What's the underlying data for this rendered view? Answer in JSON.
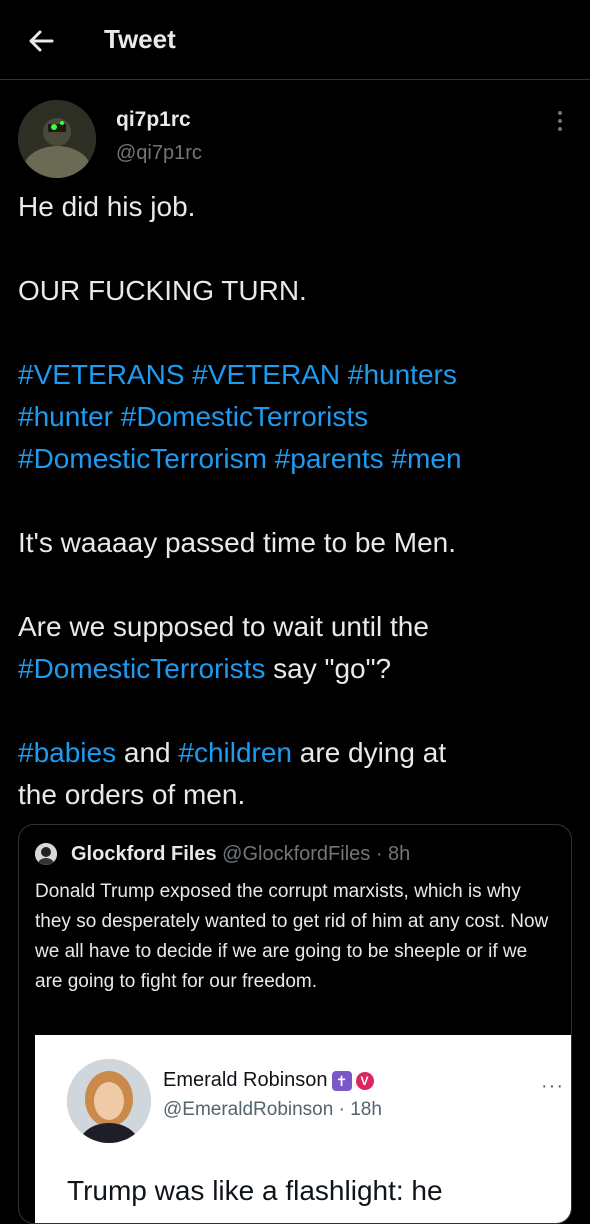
{
  "header": {
    "title": "Tweet"
  },
  "tweet": {
    "display_name": "qi7p1rc",
    "handle": "@qi7p1rc",
    "line1": "He did his job.",
    "line2": "OUR FUCKING TURN.",
    "tags_line1": [
      "#VETERANS",
      "#VETERAN",
      "#hunters"
    ],
    "tags_line2": [
      "#hunter",
      "#DomesticTerrorists"
    ],
    "tags_line3": [
      "#DomesticTerrorism",
      "#parents",
      "#men"
    ],
    "line3": "It's waaaay passed time to be Men.",
    "line4a": "Are we supposed to wait until the",
    "line4_tag": "#DomesticTerrorists",
    "line4b": " say \"go\"?",
    "line5_tag1": "#babies",
    "line5_and": " and ",
    "line5_tag2": "#children",
    "line5_rest": " are dying at",
    "line6": "the orders of men."
  },
  "quote": {
    "name": "Glockford Files",
    "meta": "@GlockfordFiles · 8h",
    "text": "Donald Trump exposed the corrupt marxists, which is why they so desperately wanted to get rid of him at any cost. Now we all have to decide if we are going to be sheeple or if we are going to fight for our freedom."
  },
  "embed": {
    "name": "Emerald Robinson",
    "handle": "@EmeraldRobinson · 18h",
    "dots": "···",
    "text": "Trump was like a flashlight: he",
    "cross_badge": "✝",
    "v_badge": "V"
  },
  "colors": {
    "accent": "#1d9bf0",
    "background": "#000000",
    "muted": "#71767b"
  }
}
